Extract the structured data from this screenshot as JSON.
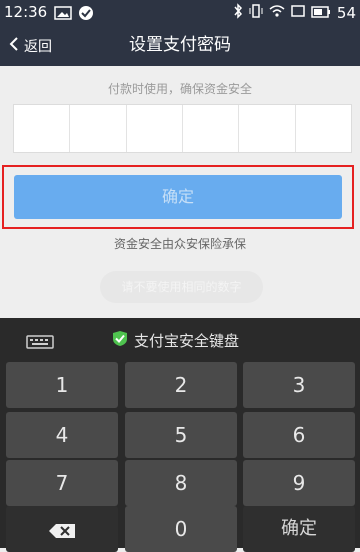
{
  "status": {
    "time": "12:36",
    "battery": "54"
  },
  "header": {
    "back_label": "返回",
    "title": "设置支付密码"
  },
  "content": {
    "hint": "付款时使用，确保资金安全",
    "confirm_label": "确定",
    "insure_text": "资金安全由众安保险承保",
    "toast_text": "请不要使用相同的数字"
  },
  "keyboard": {
    "title": "支付宝安全键盘",
    "keys": [
      "1",
      "2",
      "3",
      "4",
      "5",
      "6",
      "7",
      "8",
      "9",
      "0"
    ],
    "confirm_label": "确定"
  }
}
